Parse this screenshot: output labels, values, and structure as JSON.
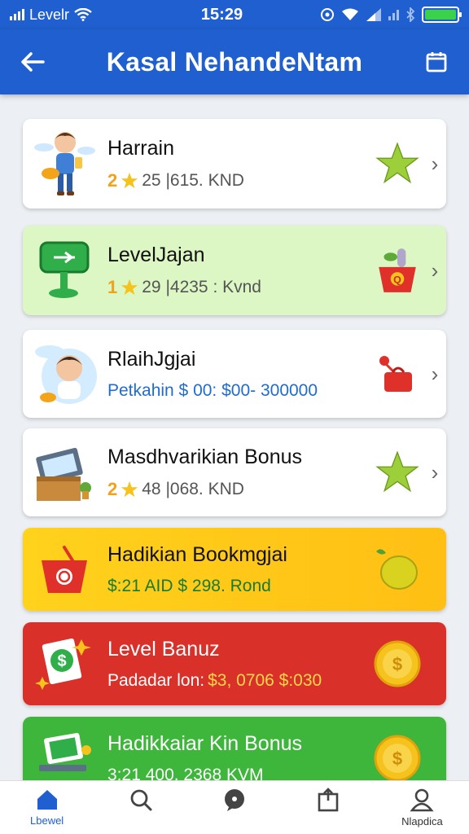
{
  "status": {
    "carrier": "Levelr",
    "time": "15:29",
    "battery_level": 1.0,
    "battery_color": "#3bd14a"
  },
  "appbar": {
    "title": "Kasal NehandeNtam",
    "back_icon": "arrow-left-icon",
    "action_icon": "calendar-icon",
    "color": "#1f5fcf"
  },
  "items": [
    {
      "name": "Harrain",
      "level": "2",
      "meta": "25 |615. KND",
      "badge_icon": "star-icon",
      "color": "#ffffff"
    },
    {
      "name": "LevelJajan",
      "level": "1",
      "meta": "29 |4235 : Kvnd",
      "badge_icon": "basket-icon",
      "color": "#dcf6c4"
    },
    {
      "name": "RlaihJgjai",
      "meta": "Petkahin $ 00: $00- 300000",
      "badge_icon": "bag-icon",
      "color": "#ffffff"
    },
    {
      "name": "Masdhvarikian Bonus",
      "level": "2",
      "meta": "48 |068. KND",
      "badge_icon": "star-icon",
      "color": "#ffffff"
    },
    {
      "name": "Hadikian Bookmgjai",
      "meta": "$:21 AID $ 298. Rond",
      "badge_icon": "lemon-icon",
      "color": "#ffcc1a"
    },
    {
      "name": "Level Banuz",
      "meta_prefix": "Padadar lon:",
      "meta": "$3, 0706 $:030",
      "badge_icon": "coin-icon",
      "color": "#d9302a"
    },
    {
      "name": "Hadikkaiar Kin Bonus",
      "meta": "3:21 400. 2368 KVM",
      "badge_icon": "coin-icon",
      "color": "#3eb53b"
    }
  ],
  "tabs": [
    {
      "label": "Lbewel",
      "icon": "home-icon",
      "active": true
    },
    {
      "label": "",
      "icon": "search-icon",
      "active": false
    },
    {
      "label": "",
      "icon": "chat-icon",
      "active": false
    },
    {
      "label": "",
      "icon": "share-icon",
      "active": false
    },
    {
      "label": "Nlapdica",
      "icon": "profile-icon",
      "active": false
    }
  ]
}
